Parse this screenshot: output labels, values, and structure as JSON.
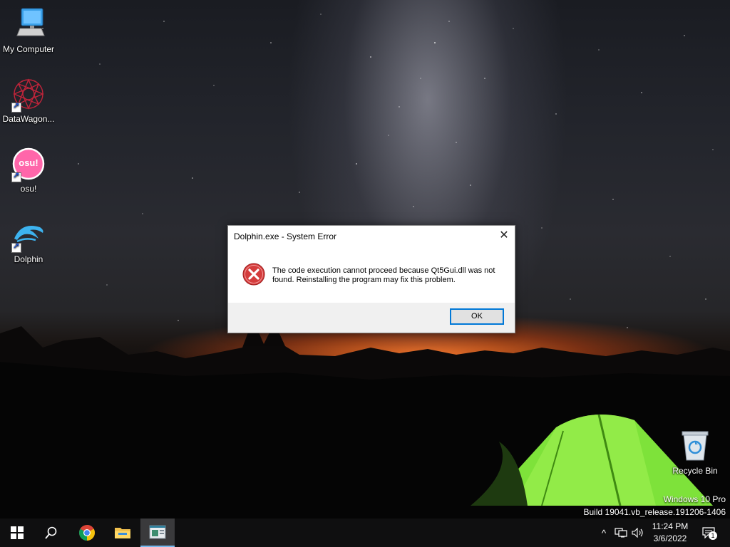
{
  "desktop": {
    "icons": [
      {
        "label": "My Computer"
      },
      {
        "label": "DataWagon..."
      },
      {
        "label": "osu!",
        "glyph": "osu!"
      },
      {
        "label": "Dolphin"
      },
      {
        "label": "Recycle Bin"
      }
    ],
    "watermark": {
      "line1": "Windows 10 Pro",
      "line2": "Build 19041.vb_release.191206-1406"
    }
  },
  "dialog": {
    "title": "Dolphin.exe - System Error",
    "close_label": "✕",
    "message": "The code execution cannot proceed because Qt5Gui.dll was not found. Reinstalling the program may fix this problem.",
    "icon": "error-icon",
    "ok_label": "OK"
  },
  "taskbar": {
    "apps": [
      {
        "name": "start-icon"
      },
      {
        "name": "search-icon"
      },
      {
        "name": "chrome-icon"
      },
      {
        "name": "file-explorer-icon"
      },
      {
        "name": "active-app-icon",
        "active": true
      }
    ],
    "tray": {
      "chevron": "^",
      "clock_time": "11:24 PM",
      "clock_date": "3/6/2022",
      "notification_count": "1"
    }
  },
  "colors": {
    "accent": "#0078d7",
    "error_red": "#d43c3c",
    "tent_green": "#7ee23a"
  }
}
